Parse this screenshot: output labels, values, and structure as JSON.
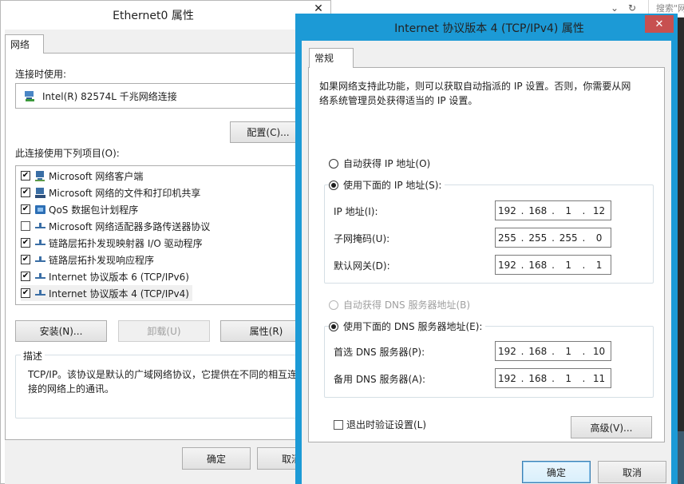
{
  "browser": {
    "close_glyph": "✕",
    "refresh_glyph": "↻",
    "chevron_glyph": "⌄",
    "search_placeholder": "搜索\"网"
  },
  "ethernet_dialog": {
    "title": "Ethernet0 属性",
    "close_glyph": "✕",
    "tab_network": "网络",
    "connect_using_label": "连接时使用:",
    "adapter_name": "Intel(R) 82574L 千兆网络连接",
    "configure_button": "配置(C)...",
    "items_label": "此连接使用下列项目(O):",
    "items": [
      {
        "label": "Microsoft 网络客户端",
        "checked": true,
        "icon": "network-client-icon"
      },
      {
        "label": "Microsoft 网络的文件和打印机共享",
        "checked": true,
        "icon": "file-share-icon"
      },
      {
        "label": "QoS 数据包计划程序",
        "checked": true,
        "icon": "qos-icon"
      },
      {
        "label": "Microsoft 网络适配器多路传送器协议",
        "checked": false,
        "icon": "protocol-icon"
      },
      {
        "label": "链路层拓扑发现映射器 I/O 驱动程序",
        "checked": true,
        "icon": "protocol-icon"
      },
      {
        "label": "链路层拓扑发现响应程序",
        "checked": true,
        "icon": "protocol-icon"
      },
      {
        "label": "Internet 协议版本 6 (TCP/IPv6)",
        "checked": true,
        "icon": "protocol-icon"
      },
      {
        "label": "Internet 协议版本 4 (TCP/IPv4)",
        "checked": true,
        "icon": "protocol-icon"
      }
    ],
    "check_glyph": "✔",
    "install_button": "安装(N)...",
    "uninstall_button": "卸载(U)",
    "properties_button": "属性(R)",
    "description_label": "描述",
    "description_text": "TCP/IP。该协议是默认的广域网络协议，它提供在不同的相互连接的网络上的通讯。",
    "description_line1": "TCP/IP。该协议是默认的广域网络协议，它提供在不同的相互连",
    "description_line2": "接的网络上的通讯。",
    "ok_button": "确定",
    "cancel_button": "取消"
  },
  "ipv4_dialog": {
    "title": "Internet 协议版本 4 (TCP/IPv4) 属性",
    "close_glyph": "✕",
    "tab_general": "常规",
    "intro_line1": "如果网络支持此功能，则可以获取自动指派的 IP 设置。否则，你需要从网",
    "intro_line2": "络系统管理员处获得适当的 IP 设置。",
    "auto_ip_label": "自动获得 IP 地址(O)",
    "manual_ip_label": "使用下面的 IP 地址(S):",
    "ip_selected": "manual",
    "ip_address_label": "IP 地址(I):",
    "ip_address": [
      "192",
      "168",
      "1",
      "12"
    ],
    "subnet_label": "子网掩码(U):",
    "subnet_mask": [
      "255",
      "255",
      "255",
      "0"
    ],
    "gateway_label": "默认网关(D):",
    "gateway": [
      "192",
      "168",
      "1",
      "1"
    ],
    "auto_dns_label": "自动获得 DNS 服务器地址(B)",
    "manual_dns_label": "使用下面的 DNS 服务器地址(E):",
    "dns_selected": "manual",
    "preferred_dns_label": "首选 DNS 服务器(P):",
    "preferred_dns": [
      "192",
      "168",
      "1",
      "10"
    ],
    "alternate_dns_label": "备用 DNS 服务器(A):",
    "alternate_dns": [
      "192",
      "168",
      "1",
      "11"
    ],
    "validate_on_exit_label": "退出时验证设置(L)",
    "validate_on_exit_checked": false,
    "advanced_button": "高级(V)...",
    "ok_button": "确定",
    "cancel_button": "取消"
  },
  "colors": {
    "accent_border": "#1c9ad6",
    "close_button": "#c75050",
    "dialog_bg": "#f0f0f0"
  }
}
